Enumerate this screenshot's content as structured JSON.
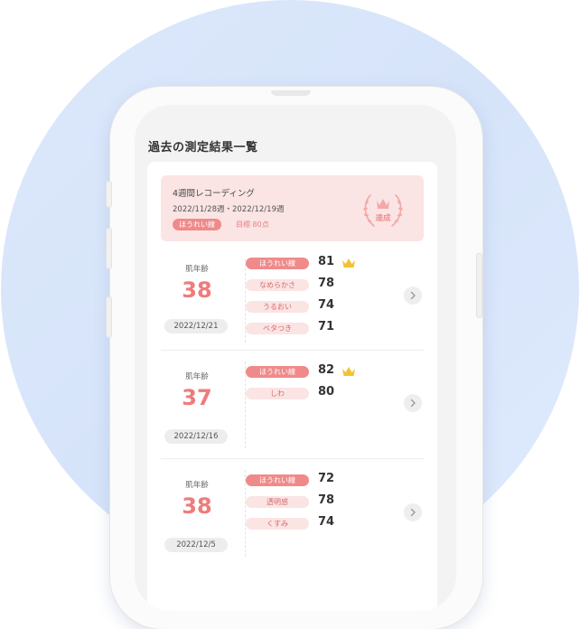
{
  "header": {
    "title": "過去の測定結果一覧"
  },
  "banner": {
    "title": "4週間レコーディング",
    "period": "2022/11/28週・2022/12/19週",
    "tag": "ほうれい線",
    "goal": "目標 80点",
    "badge_label": "達成",
    "badge_icon": "crown-laurel-icon"
  },
  "records": [
    {
      "age_label": "肌年齢",
      "age": "38",
      "date": "2022/12/21",
      "metrics": [
        {
          "label": "ほうれい線",
          "score": "81",
          "primary": true,
          "crown": true
        },
        {
          "label": "なめらかさ",
          "score": "78"
        },
        {
          "label": "うるおい",
          "score": "74"
        },
        {
          "label": "ベタつき",
          "score": "71"
        }
      ]
    },
    {
      "age_label": "肌年齢",
      "age": "37",
      "date": "2022/12/16",
      "metrics": [
        {
          "label": "ほうれい線",
          "score": "82",
          "primary": true,
          "crown": true
        },
        {
          "label": "しわ",
          "score": "80"
        }
      ]
    },
    {
      "age_label": "肌年齢",
      "age": "38",
      "date": "2022/12/5",
      "metrics": [
        {
          "label": "ほうれい線",
          "score": "72",
          "primary": true
        },
        {
          "label": "透明感",
          "score": "78"
        },
        {
          "label": "くすみ",
          "score": "74"
        }
      ]
    }
  ],
  "colors": {
    "accent": "#f08a8a",
    "accent_light": "#fbe4e4",
    "crown": "#f2c230",
    "background": "#dce8fb"
  }
}
